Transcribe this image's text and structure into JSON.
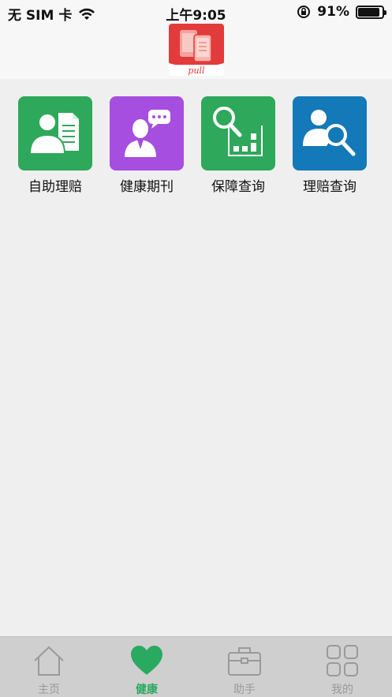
{
  "status_bar": {
    "carrier": "无 SIM 卡",
    "time": "上午9:05",
    "battery_pct": "91%",
    "battery_level": 0.91
  },
  "header": {
    "logo_text": "pull"
  },
  "grid": {
    "items": [
      {
        "label": "自助理赔",
        "color": "#2ea85a",
        "icon": "user-document-icon"
      },
      {
        "label": "健康期刊",
        "color": "#a64ee0",
        "icon": "user-chat-icon"
      },
      {
        "label": "保障查询",
        "color": "#2ea85a",
        "icon": "search-chart-icon"
      },
      {
        "label": "理赔查询",
        "color": "#1479b8",
        "icon": "user-search-icon"
      }
    ]
  },
  "tab_bar": {
    "active_color": "#2aa961",
    "inactive_color": "#9a9a9a",
    "items": [
      {
        "label": "主页",
        "icon": "home-icon",
        "active": false
      },
      {
        "label": "健康",
        "icon": "heart-icon",
        "active": true
      },
      {
        "label": "助手",
        "icon": "briefcase-icon",
        "active": false
      },
      {
        "label": "我的",
        "icon": "grid-icon",
        "active": false
      }
    ]
  }
}
